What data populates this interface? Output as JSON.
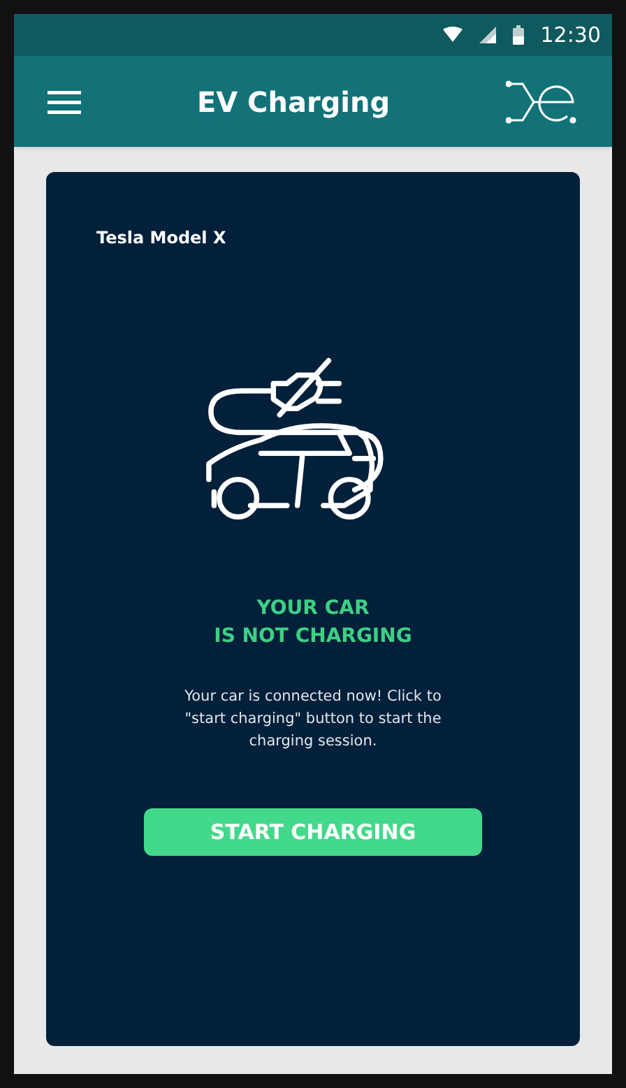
{
  "status_bar": {
    "time": "12:30"
  },
  "app_bar": {
    "title": "EV Charging"
  },
  "card": {
    "vehicle": "Tesla Model X",
    "status_lines": [
      "YOUR CAR",
      "IS NOT CHARGING"
    ],
    "message": "Your car is connected now! Click to \"start charging\" button to start the charging session.",
    "button": "START CHARGING"
  }
}
